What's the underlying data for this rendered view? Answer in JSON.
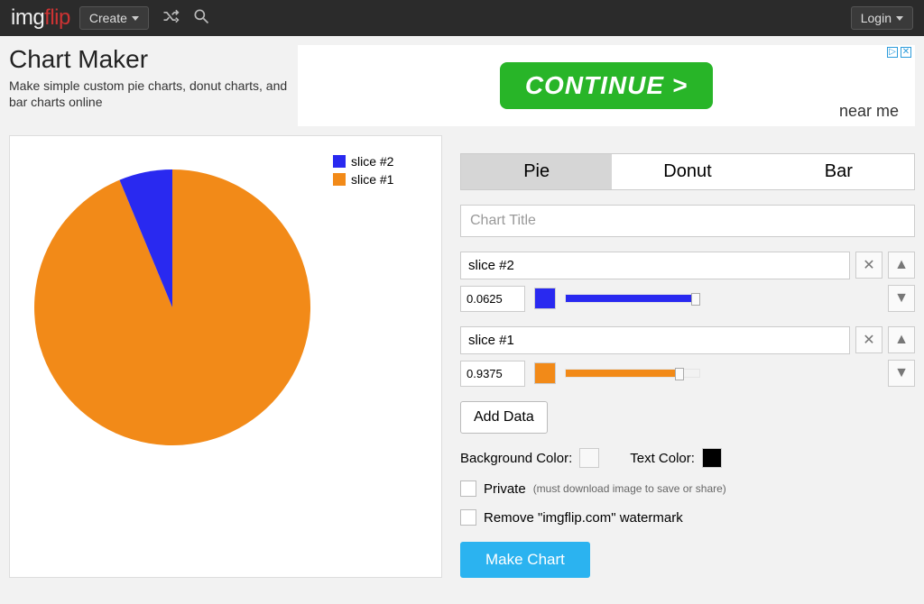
{
  "chart_data": {
    "type": "pie",
    "title": "",
    "series": [
      {
        "name": "slice #2",
        "value": 0.0625,
        "color": "#2929f0"
      },
      {
        "name": "slice #1",
        "value": 0.9375,
        "color": "#f28a18"
      }
    ]
  },
  "topbar": {
    "logo_a": "img",
    "logo_b": "flip",
    "create": "Create",
    "login": "Login"
  },
  "header": {
    "title": "Chart Maker",
    "subtitle": "Make simple custom pie charts, donut charts, and bar charts online"
  },
  "ad": {
    "cta": "CONTINUE >",
    "sub": "near me",
    "close": "✕",
    "info": "▷"
  },
  "tabs": {
    "pie": "Pie",
    "donut": "Donut",
    "bar": "Bar"
  },
  "title_placeholder": "Chart Title",
  "slices": [
    {
      "name": "slice #2",
      "value": "0.0625",
      "color": "#2929f0",
      "fillpct": 97,
      "thumbpct": 97
    },
    {
      "name": "slice #1",
      "value": "0.9375",
      "color": "#f28a18",
      "fillpct": 85,
      "thumbpct": 85
    }
  ],
  "add_data": "Add Data",
  "bgcolor_label": "Background Color:",
  "bgcolor": "#f8f8f8",
  "textcolor_label": "Text Color:",
  "textcolor": "#000000",
  "private_label": "Private",
  "private_hint": "(must download image to save or share)",
  "watermark_label": "Remove \"imgflip.com\" watermark",
  "make": "Make Chart",
  "legend": [
    {
      "label": "slice #2",
      "color": "#2929f0"
    },
    {
      "label": "slice #1",
      "color": "#f28a18"
    }
  ]
}
